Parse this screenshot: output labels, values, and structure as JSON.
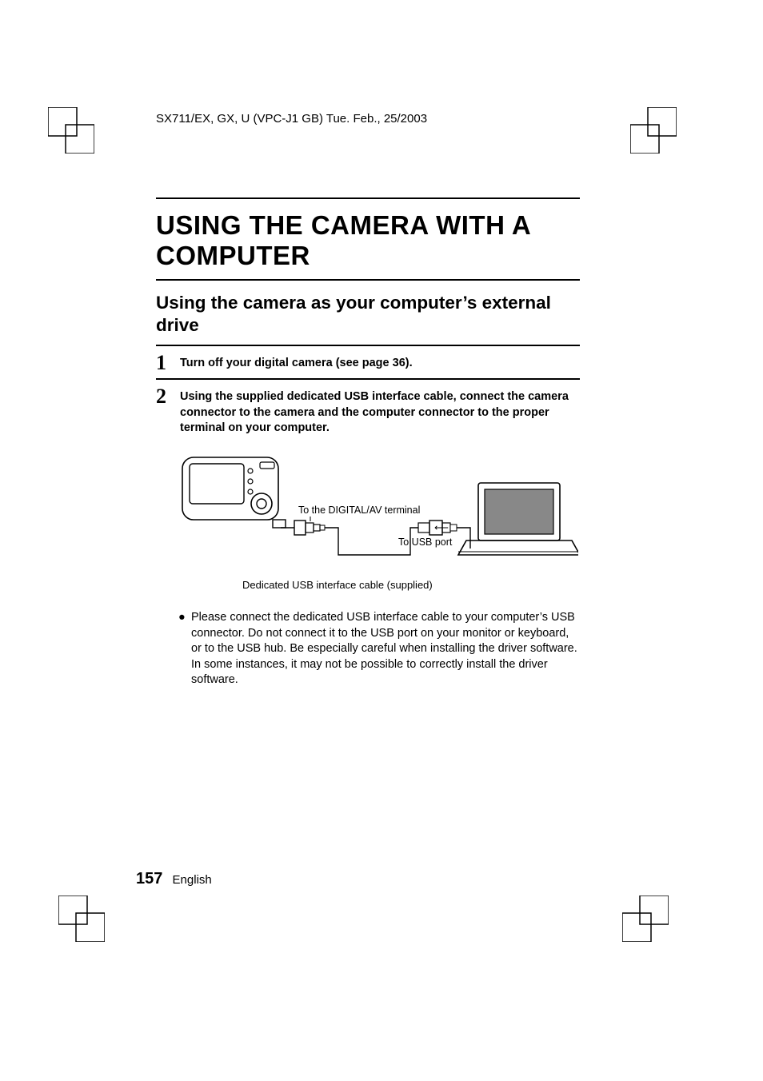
{
  "header": "SX711/EX, GX, U (VPC-J1 GB)    Tue. Feb., 25/2003",
  "title": "USING THE CAMERA WITH A COMPUTER",
  "subtitle": "Using the camera as your computer’s external drive",
  "steps": [
    {
      "num": "1",
      "body": "Turn off your digital camera (see page 36)."
    },
    {
      "num": "2",
      "body": "Using the supplied dedicated USB interface cable, connect the camera connector to the camera and the computer connector to the proper terminal on your computer."
    }
  ],
  "diagram": {
    "label_terminal": "To the DIGITAL/AV terminal",
    "label_usb": "To USB port",
    "caption": "Dedicated USB interface cable (supplied)"
  },
  "bullet": "Please connect the dedicated USB interface cable to your computer’s USB connector. Do not connect it to the USB port on your monitor or keyboard, or to the USB hub. Be especially careful when installing the driver software. In some instances, it may not be possible to correctly install the driver software.",
  "footer": {
    "page": "157",
    "lang": "English"
  }
}
